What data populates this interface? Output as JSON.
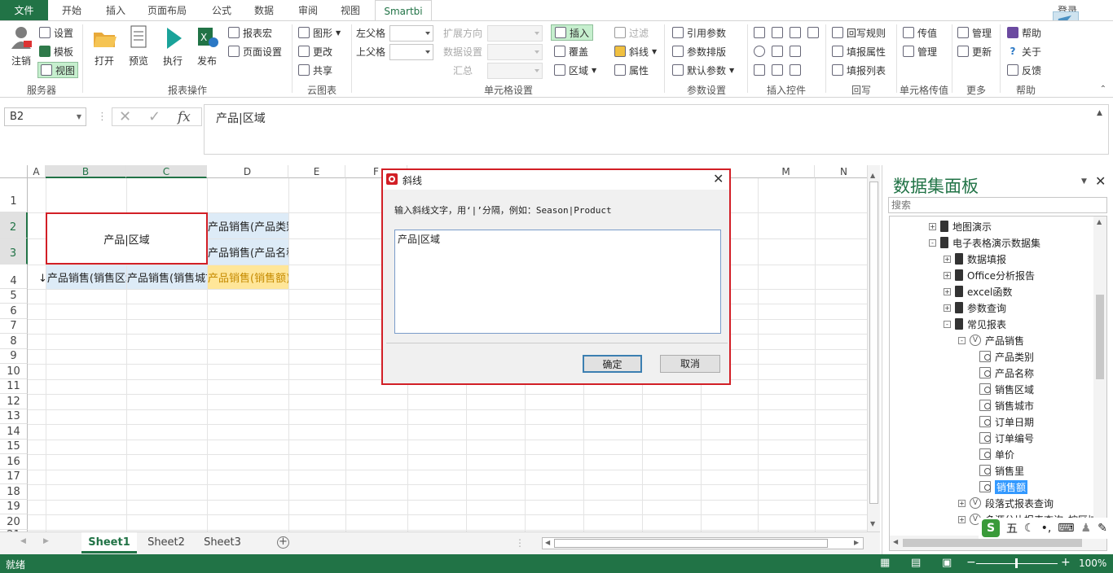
{
  "tabs": {
    "file": "文件",
    "items": [
      "开始",
      "插入",
      "页面布局",
      "公式",
      "数据",
      "审阅",
      "视图",
      "Smartbi"
    ],
    "login": "登录"
  },
  "ribbon": {
    "server": {
      "logout": "注销",
      "settings": "设置",
      "template": "模板",
      "view": "视图",
      "label": "服务器"
    },
    "report": {
      "open": "打开",
      "preview": "预览",
      "execute": "执行",
      "publish": "发布",
      "report_macro": "报表宏",
      "page_setup": "页面设置",
      "label": "报表操作"
    },
    "cloud": {
      "chart": "图形",
      "update": "更改",
      "share": "共享",
      "label": "云图表"
    },
    "cell_settings": {
      "left_parent": "左父格",
      "up_parent": "上父格",
      "expand_direction": "扩展方向",
      "data_settings": "数据设置",
      "summary": "汇总",
      "insert": "插入",
      "cover": "覆盖",
      "area": "区域",
      "filter": "过滤",
      "diagonal": "斜线",
      "properties": "属性",
      "label": "单元格设置"
    },
    "params": {
      "ref_param": "引用参数",
      "param_layout": "参数排版",
      "default_param": "默认参数",
      "label": "参数设置"
    },
    "controls": {
      "label": "插入控件"
    },
    "writeback": {
      "rules": "回写规则",
      "fill_props": "填报属性",
      "fill_list": "填报列表",
      "label": "回写"
    },
    "cell_value": {
      "pass_value": "传值",
      "manage": "管理",
      "label": "单元格传值"
    },
    "more": {
      "manage": "管理",
      "update": "更新",
      "label": "更多"
    },
    "help": {
      "help": "帮助",
      "about": "关于",
      "feedback": "反馈",
      "label": "帮助"
    }
  },
  "formula_bar": {
    "name_box": "B2",
    "formula": "产品|区域"
  },
  "grid": {
    "columns": [
      "A",
      "B",
      "C",
      "D",
      "E",
      "F",
      "M",
      "N"
    ],
    "rows": [
      "1",
      "2",
      "3",
      "4",
      "5",
      "6",
      "7",
      "8",
      "9",
      "10",
      "11",
      "12",
      "13",
      "14",
      "15",
      "16",
      "17",
      "18",
      "19",
      "20",
      "21"
    ],
    "cells": {
      "b2": "产品|区域",
      "d2": "产品销售(产品类别)",
      "d3": "产品销售(产品名称)",
      "b4": "↓产品销售(销售区域)",
      "c4": "产品销售(销售城市)",
      "d4": "产品销售(销售额)"
    }
  },
  "sheets": [
    "Sheet1",
    "Sheet2",
    "Sheet3"
  ],
  "status": {
    "ready": "就绪",
    "zoom": "100%"
  },
  "panel": {
    "title": "数据集面板",
    "search_placeholder": "搜索",
    "tree": [
      {
        "label": "地图演示",
        "level": 1,
        "icon": "db",
        "expander": "+"
      },
      {
        "label": "电子表格演示数据集",
        "level": 1,
        "icon": "db",
        "expander": "-"
      },
      {
        "label": "数据填报",
        "level": 2,
        "icon": "db",
        "expander": "+"
      },
      {
        "label": "Office分析报告",
        "level": 2,
        "icon": "db",
        "expander": "+"
      },
      {
        "label": "excel函数",
        "level": 2,
        "icon": "db",
        "expander": "+"
      },
      {
        "label": "参数查询",
        "level": 2,
        "icon": "db",
        "expander": "+"
      },
      {
        "label": "常见报表",
        "level": 2,
        "icon": "db",
        "expander": "-"
      },
      {
        "label": "产品销售",
        "level": 3,
        "icon": "view",
        "expander": "-"
      },
      {
        "label": "产品类别",
        "level": 4,
        "icon": "field",
        "expander": ""
      },
      {
        "label": "产品名称",
        "level": 4,
        "icon": "field",
        "expander": ""
      },
      {
        "label": "销售区域",
        "level": 4,
        "icon": "field",
        "expander": ""
      },
      {
        "label": "销售城市",
        "level": 4,
        "icon": "field",
        "expander": ""
      },
      {
        "label": "订单日期",
        "level": 4,
        "icon": "field",
        "expander": ""
      },
      {
        "label": "订单编号",
        "level": 4,
        "icon": "field",
        "expander": ""
      },
      {
        "label": "单价",
        "level": 4,
        "icon": "field",
        "expander": ""
      },
      {
        "label": "销售里",
        "level": 4,
        "icon": "field",
        "expander": ""
      },
      {
        "label": "销售额",
        "level": 4,
        "icon": "field",
        "expander": "",
        "selected": true
      },
      {
        "label": "段落式报表查询",
        "level": 3,
        "icon": "view",
        "expander": "+"
      },
      {
        "label": "多源分片报表查询_按区域",
        "level": 3,
        "icon": "view",
        "expander": "+"
      }
    ]
  },
  "dialog": {
    "title": "斜线",
    "instruction": "输入斜线文字，用‘|’分隔，例如：Season|Product",
    "text": "产品|区域",
    "ok": "确定",
    "cancel": "取消"
  },
  "ime": {
    "label": "五"
  },
  "colors": {
    "excel_green": "#217346",
    "highlight_red": "#d21f26",
    "header_blue": "#ddebf7",
    "value_yellow": "#ffe699"
  }
}
